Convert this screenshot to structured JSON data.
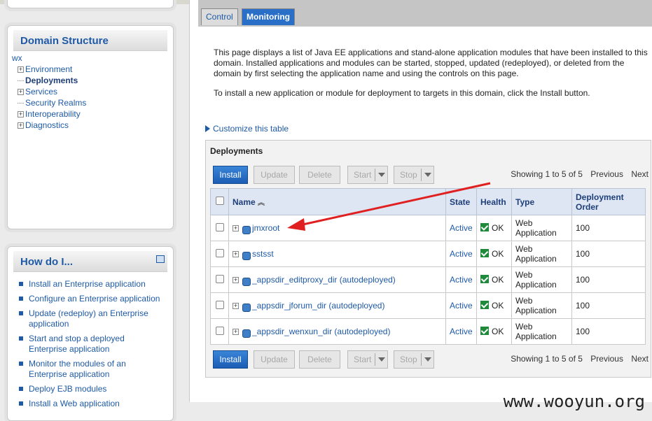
{
  "sidebar": {
    "domain_structure": {
      "title": "Domain Structure",
      "root": "wx",
      "items": [
        {
          "label": "Environment",
          "expandable": true
        },
        {
          "label": "Deployments",
          "expandable": false,
          "selected": true
        },
        {
          "label": "Services",
          "expandable": true
        },
        {
          "label": "Security Realms",
          "expandable": false
        },
        {
          "label": "Interoperability",
          "expandable": true
        },
        {
          "label": "Diagnostics",
          "expandable": true
        }
      ]
    },
    "how_do_i": {
      "title": "How do I...",
      "items": [
        "Install an Enterprise application",
        "Configure an Enterprise application",
        "Update (redeploy) an Enterprise application",
        "Start and stop a deployed Enterprise application",
        "Monitor the modules of an Enterprise application",
        "Deploy EJB modules",
        "Install a Web application"
      ]
    }
  },
  "tabs": {
    "control": "Control",
    "monitoring": "Monitoring"
  },
  "description": {
    "p1": "This page displays a list of Java EE applications and stand-alone application modules that have been installed to this domain. Installed applications and modules can be started, stopped, updated (redeployed), or deleted from the domain by first selecting the application name and using the controls on this page.",
    "p2": "To install a new application or module for deployment to targets in this domain, click the Install button."
  },
  "customize_link": "Customize this table",
  "deployments": {
    "title": "Deployments",
    "buttons": {
      "install": "Install",
      "update": "Update",
      "delete": "Delete",
      "start": "Start",
      "stop": "Stop"
    },
    "paging": {
      "showing": "Showing 1 to 5 of 5",
      "previous": "Previous",
      "next": "Next"
    },
    "columns": {
      "name": "Name",
      "state": "State",
      "health": "Health",
      "type": "Type",
      "order": "Deployment Order"
    },
    "rows": [
      {
        "name": "jmxroot",
        "state": "Active",
        "health": "OK",
        "type": "Web Application",
        "order": "100"
      },
      {
        "name": "sstsst",
        "state": "Active",
        "health": "OK",
        "type": "Web Application",
        "order": "100"
      },
      {
        "name": "_appsdir_editproxy_dir (autodeployed)",
        "state": "Active",
        "health": "OK",
        "type": "Web Application",
        "order": "100"
      },
      {
        "name": "_appsdir_jforum_dir (autodeployed)",
        "state": "Active",
        "health": "OK",
        "type": "Web Application",
        "order": "100"
      },
      {
        "name": "_appsdir_wenxun_dir (autodeployed)",
        "state": "Active",
        "health": "OK",
        "type": "Web Application",
        "order": "100"
      }
    ]
  },
  "watermark": "www.wooyun.org",
  "colors": {
    "accent": "#1f5aa6",
    "tab_active": "#2a6fc7",
    "annotation_arrow": "#e02020"
  }
}
